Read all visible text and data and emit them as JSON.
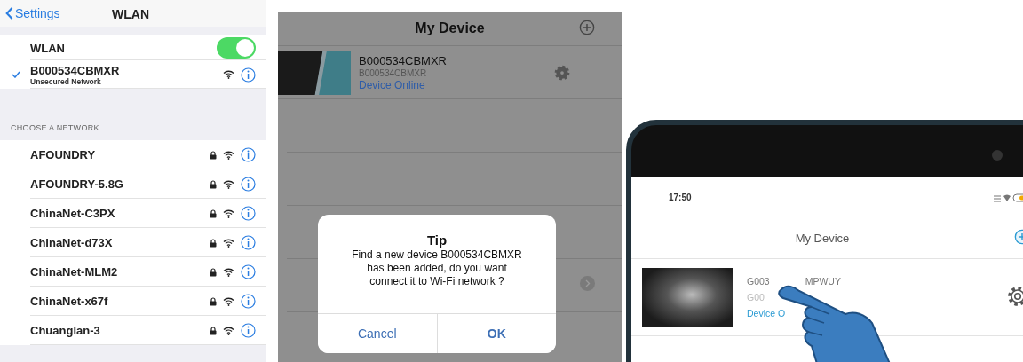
{
  "wlan_settings": {
    "back_button": "Settings",
    "title": "WLAN",
    "wlan_toggle": {
      "label": "WLAN",
      "on": true
    },
    "connected_network": {
      "name": "B000534CBMXR",
      "subtitle": "Unsecured Network",
      "checked": true
    },
    "section_header": "CHOOSE A NETWORK...",
    "networks": [
      {
        "name": "AFOUNDRY",
        "secured": true
      },
      {
        "name": "AFOUNDRY-5.8G",
        "secured": true
      },
      {
        "name": "ChinaNet-C3PX",
        "secured": true
      },
      {
        "name": "ChinaNet-d73X",
        "secured": true
      },
      {
        "name": "ChinaNet-MLM2",
        "secured": true
      },
      {
        "name": "ChinaNet-x67f",
        "secured": true
      },
      {
        "name": "Chuanglan-3",
        "secured": true
      }
    ]
  },
  "device_dialog_screen": {
    "title": "My Device",
    "device": {
      "name": "B000534CBMXR",
      "id": "B000534CBMXR",
      "status": "Device Online"
    },
    "dialog": {
      "title": "Tip",
      "message": "Find a new device B000534CBMXR has been added, do you want connect it to Wi-Fi network ?",
      "buttons": [
        "Cancel",
        "OK"
      ]
    }
  },
  "phone_screen": {
    "status_time": "17:50",
    "title": "My Device",
    "device": {
      "name_parts": [
        "G003",
        "MPWUY"
      ],
      "id": "G00",
      "status": "Device O"
    }
  }
}
